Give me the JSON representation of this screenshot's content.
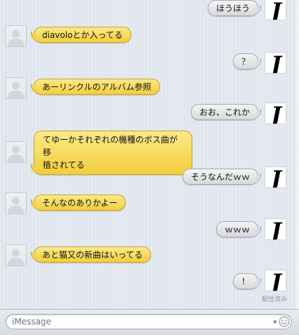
{
  "conversation": {
    "messages": [
      {
        "sender": "self",
        "text": "ほうほう"
      },
      {
        "sender": "other",
        "text": "diavoloとか入ってる"
      },
      {
        "sender": "self",
        "text": "？"
      },
      {
        "sender": "other",
        "text": "あーリンクルのアルバム参照"
      },
      {
        "sender": "self",
        "text": "おお、これか"
      },
      {
        "sender": "other",
        "line1": "てゆーかそれぞれの機種のボス曲が移",
        "line2": "植されてる"
      },
      {
        "sender": "self",
        "text": "そうなんだｗｗ"
      },
      {
        "sender": "other",
        "text": "そんなのありかよー"
      },
      {
        "sender": "self",
        "text": "ｗｗｗ"
      },
      {
        "sender": "other",
        "text": "あと猫又の新曲はいってる"
      },
      {
        "sender": "self",
        "text": "！"
      }
    ],
    "read_status": "配信済み",
    "self_avatar_letter": "J"
  },
  "input": {
    "placeholder": "iMessage",
    "value": ""
  },
  "colors": {
    "incoming_bubble": "#f3d24a",
    "outgoing_bubble": "#e3e4e6",
    "background": "#e1e5ee"
  },
  "icons": {
    "other_avatar": "person-silhouette-icon",
    "self_avatar": "blackletter-j-icon",
    "emoji": "smiley-icon",
    "dropdown": "chevron-down-icon"
  }
}
